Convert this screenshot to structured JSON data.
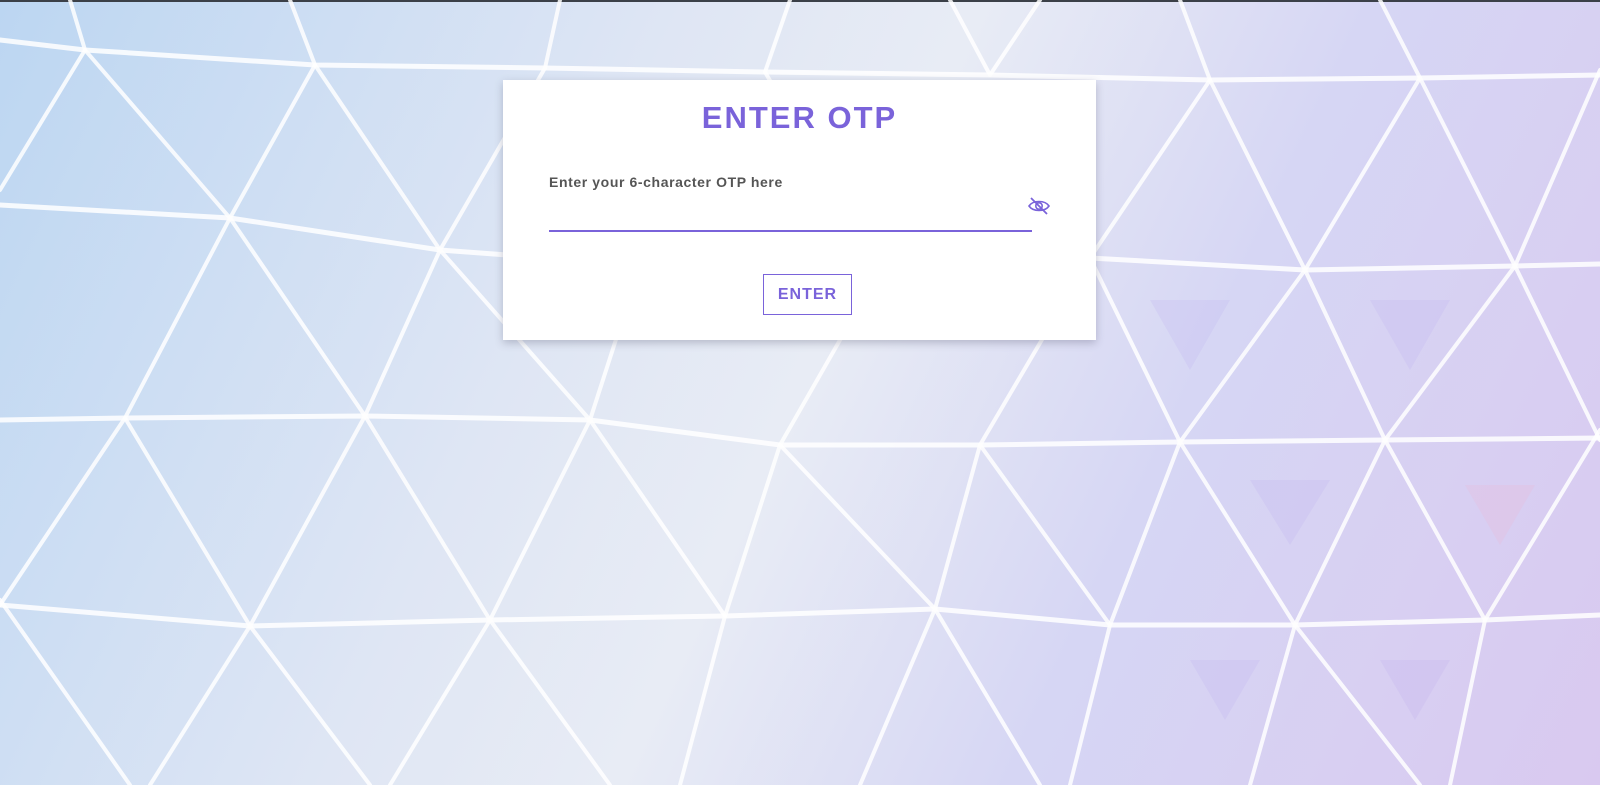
{
  "card": {
    "title": "ENTER OTP",
    "field_label": "Enter your 6-character OTP here",
    "otp_value": "",
    "eye_icon": "eye-slash-icon",
    "enter_button_label": "ENTER"
  },
  "colors": {
    "accent": "#7a63da",
    "label": "#555555",
    "card_bg": "#ffffff",
    "top_bar": "#3b4048"
  },
  "background": {
    "pattern": "triangular-geodesic-mesh",
    "tones": [
      "#bcd6f2",
      "#e8ecf5",
      "#d9c9f0"
    ]
  }
}
